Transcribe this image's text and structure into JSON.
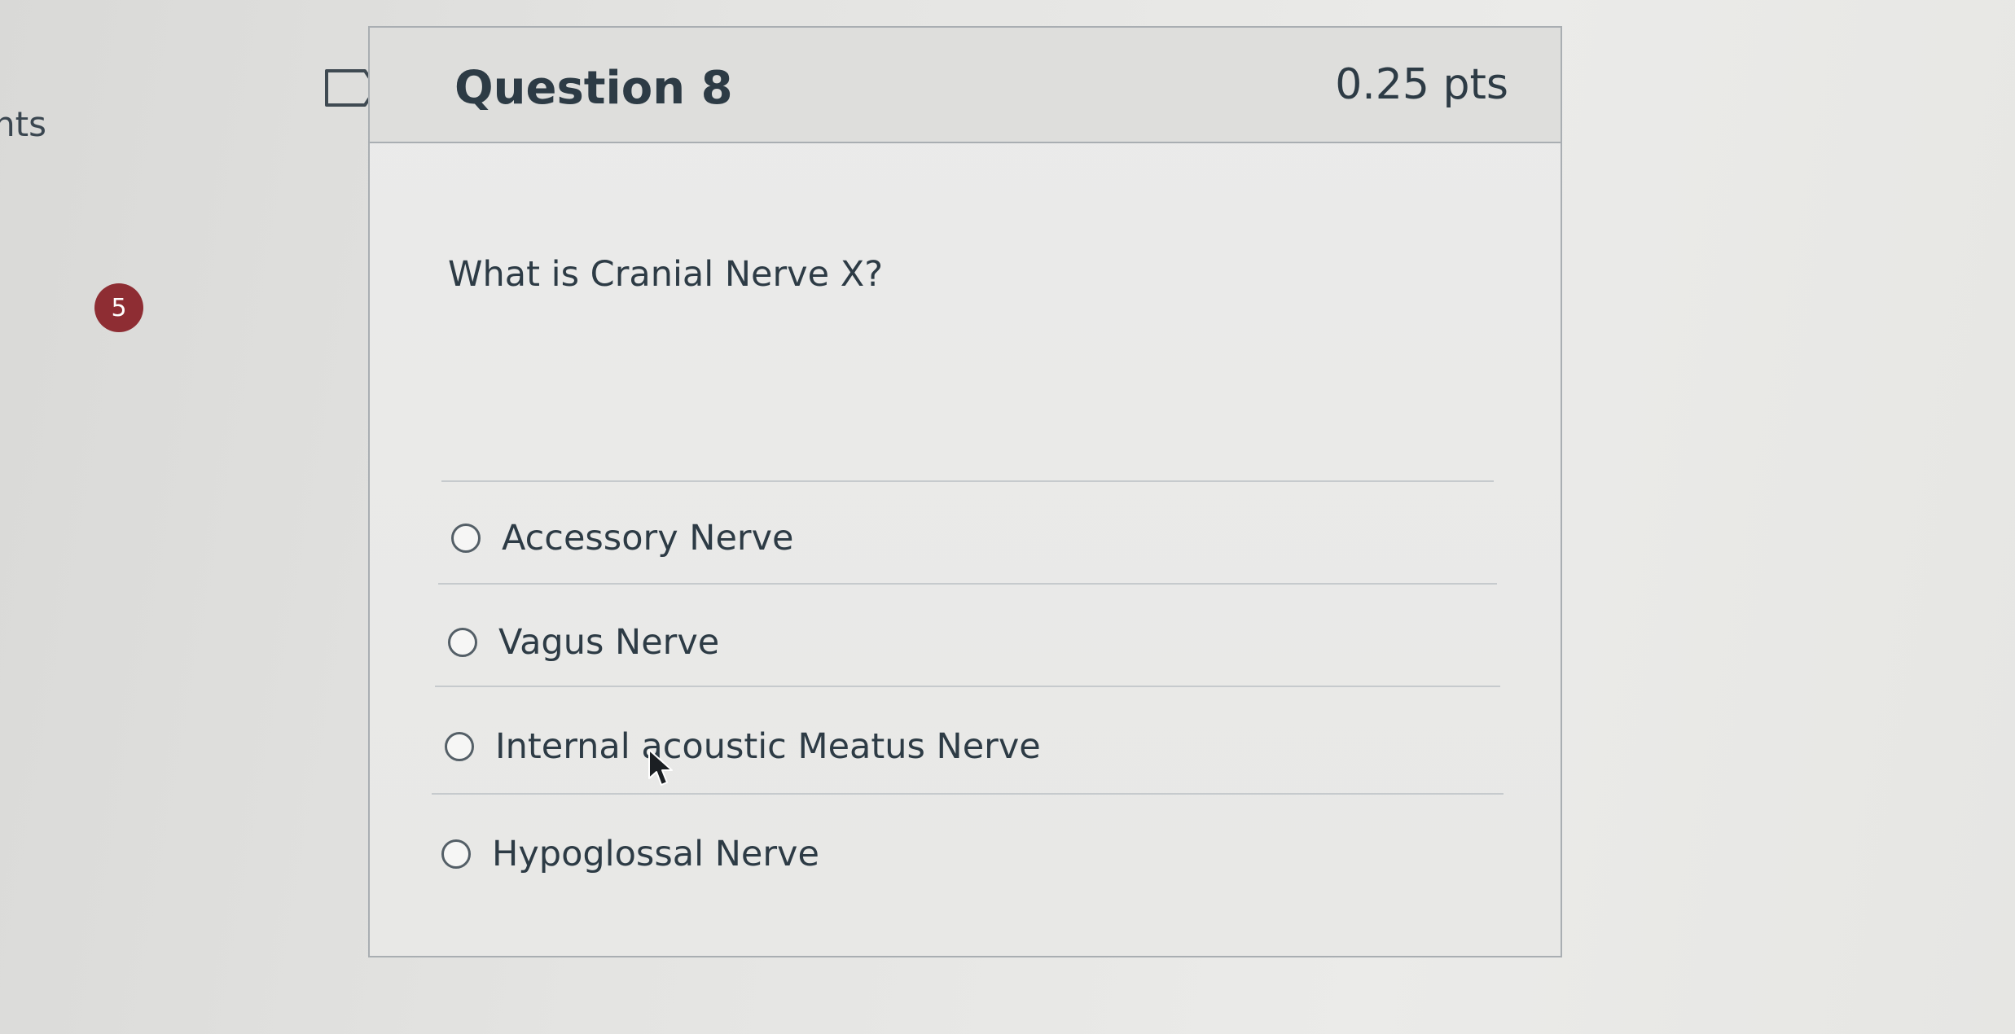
{
  "left_column": {
    "edge_text": "nts",
    "badge_count": "5"
  },
  "question": {
    "title": "Question 8",
    "points": "0.25 pts",
    "text": "What is Cranial Nerve X?",
    "answers": [
      {
        "label": "Accessory Nerve"
      },
      {
        "label": "Vagus Nerve"
      },
      {
        "label": "Internal acoustic Meatus Nerve"
      },
      {
        "label": "Hypoglossal Nerve"
      }
    ]
  },
  "icons": {
    "flag": "flag-outline-icon",
    "cursor": "mouse-pointer-icon"
  },
  "colors": {
    "badge": "#8e2d33",
    "text": "#2d3b45",
    "border": "#a9aeb2"
  }
}
